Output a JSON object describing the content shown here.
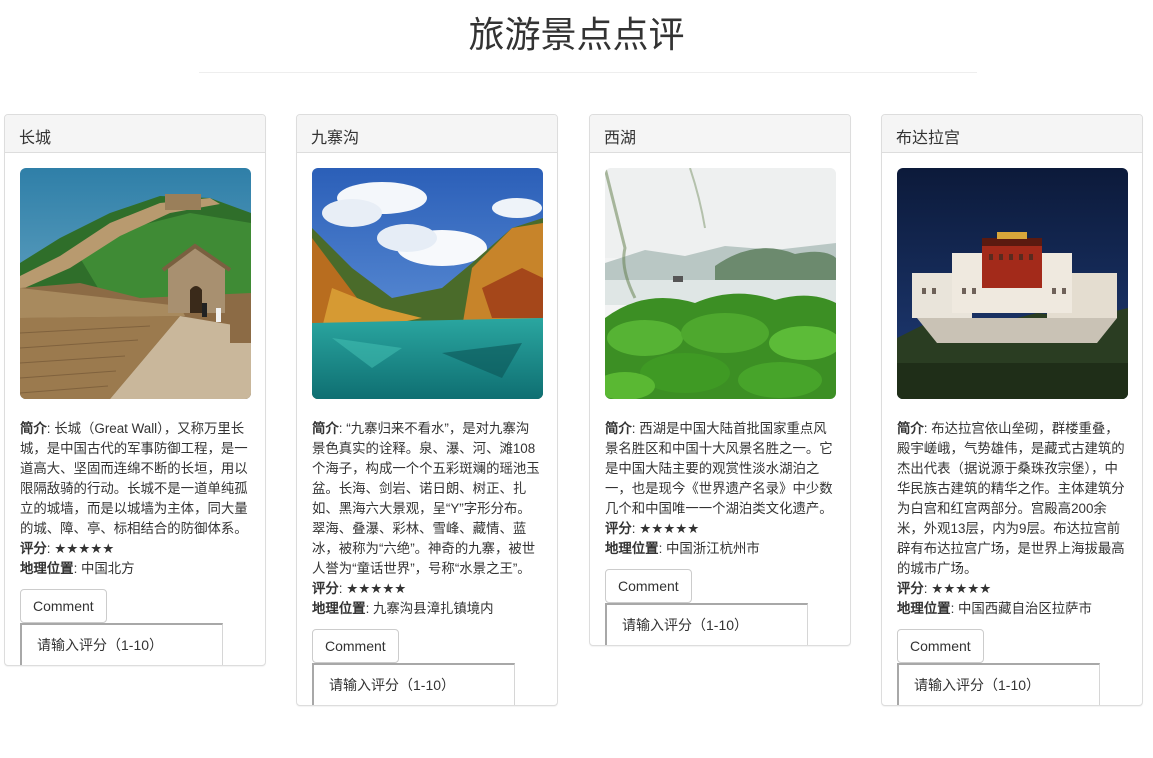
{
  "page": {
    "title": "旅游景点点评"
  },
  "labels": {
    "intro": "简介",
    "rating": "评分",
    "location": "地理位置"
  },
  "cards": [
    {
      "name": "长城",
      "intro": "长城（Great Wall），又称万里长城，是中国古代的军事防御工程，是一道高大、坚固而连绵不断的长垣，用以限隔敌骑的行动。长城不是一道单纯孤立的城墙，而是以城墙为主体，同大量的城、障、亭、标相结合的防御体系。",
      "rating": "★★★★★",
      "location": "中国北方",
      "comment_label": "Comment",
      "input_placeholder": "请输入评分（1-10）"
    },
    {
      "name": "九寨沟",
      "intro": "“九寨归来不看水”，是对九寨沟景色真实的诠释。泉、瀑、河、滩108个海子，构成一个个五彩斑斓的瑶池玉盆。长海、剑岩、诺日朗、树正、扎如、黑海六大景观，呈“Y”字形分布。翠海、叠瀑、彩林、雪峰、藏情、蓝冰，被称为“六绝”。神奇的九寨，被世人誉为“童话世界”，号称“水景之王”。",
      "rating": "★★★★★",
      "location": "九寨沟县漳扎镇境内",
      "comment_label": "Comment",
      "input_placeholder": "请输入评分（1-10）"
    },
    {
      "name": "西湖",
      "intro": "西湖是中国大陆首批国家重点风景名胜区和中国十大风景名胜之一。它是中国大陆主要的观赏性淡水湖泊之一，也是现今《世界遗产名录》中少数几个和中国唯一一个湖泊类文化遗产。",
      "rating": "★★★★★",
      "location": "中国浙江杭州市",
      "comment_label": "Comment",
      "input_placeholder": "请输入评分（1-10）"
    },
    {
      "name": "布达拉宫",
      "intro": "布达拉宫依山垒砌，群楼重叠，殿宇嵯峨，气势雄伟，是藏式古建筑的杰出代表（据说源于桑珠孜宗堡），中华民族古建筑的精华之作。主体建筑分为白宫和红宫两部分。宫殿高200余米，外观13层，内为9层。布达拉宫前辟有布达拉宫广场，是世界上海拔最高的城市广场。",
      "rating": "★★★★★",
      "location": "中国西藏自治区拉萨市",
      "comment_label": "Comment",
      "input_placeholder": "请输入评分（1-10）"
    }
  ]
}
